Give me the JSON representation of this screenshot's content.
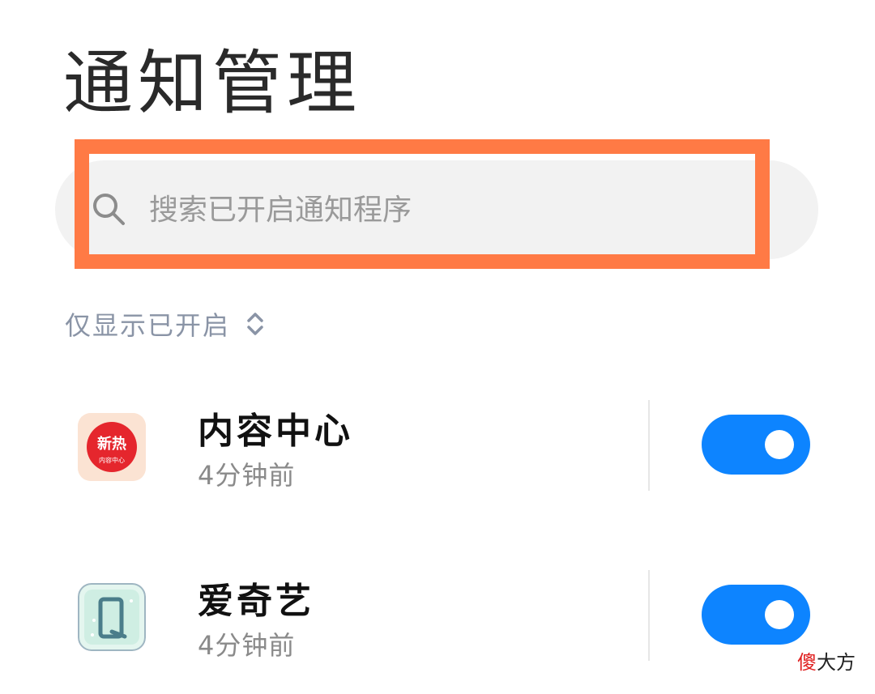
{
  "header": {
    "title": "通知管理"
  },
  "search": {
    "placeholder": "搜索已开启通知程序",
    "icon": "search-icon"
  },
  "filter": {
    "label": "仅显示已开启",
    "icon": "sort-chevrons-icon"
  },
  "apps": [
    {
      "name": "内容中心",
      "last_notified": "4分钟前",
      "icon": "content-center-app-icon",
      "icon_text_main": "新热",
      "icon_text_sub": "内容中心",
      "notifications_enabled": true
    },
    {
      "name": "爱奇艺",
      "last_notified": "4分钟前",
      "icon": "iqiyi-app-icon",
      "notifications_enabled": true
    }
  ],
  "watermark": {
    "first_char": "傻",
    "rest": "大方"
  },
  "colors": {
    "accent": "#0d84ff",
    "highlight_border": "#ff7a45",
    "search_bg": "#f2f2f2",
    "filter_text": "#8a94a6"
  }
}
